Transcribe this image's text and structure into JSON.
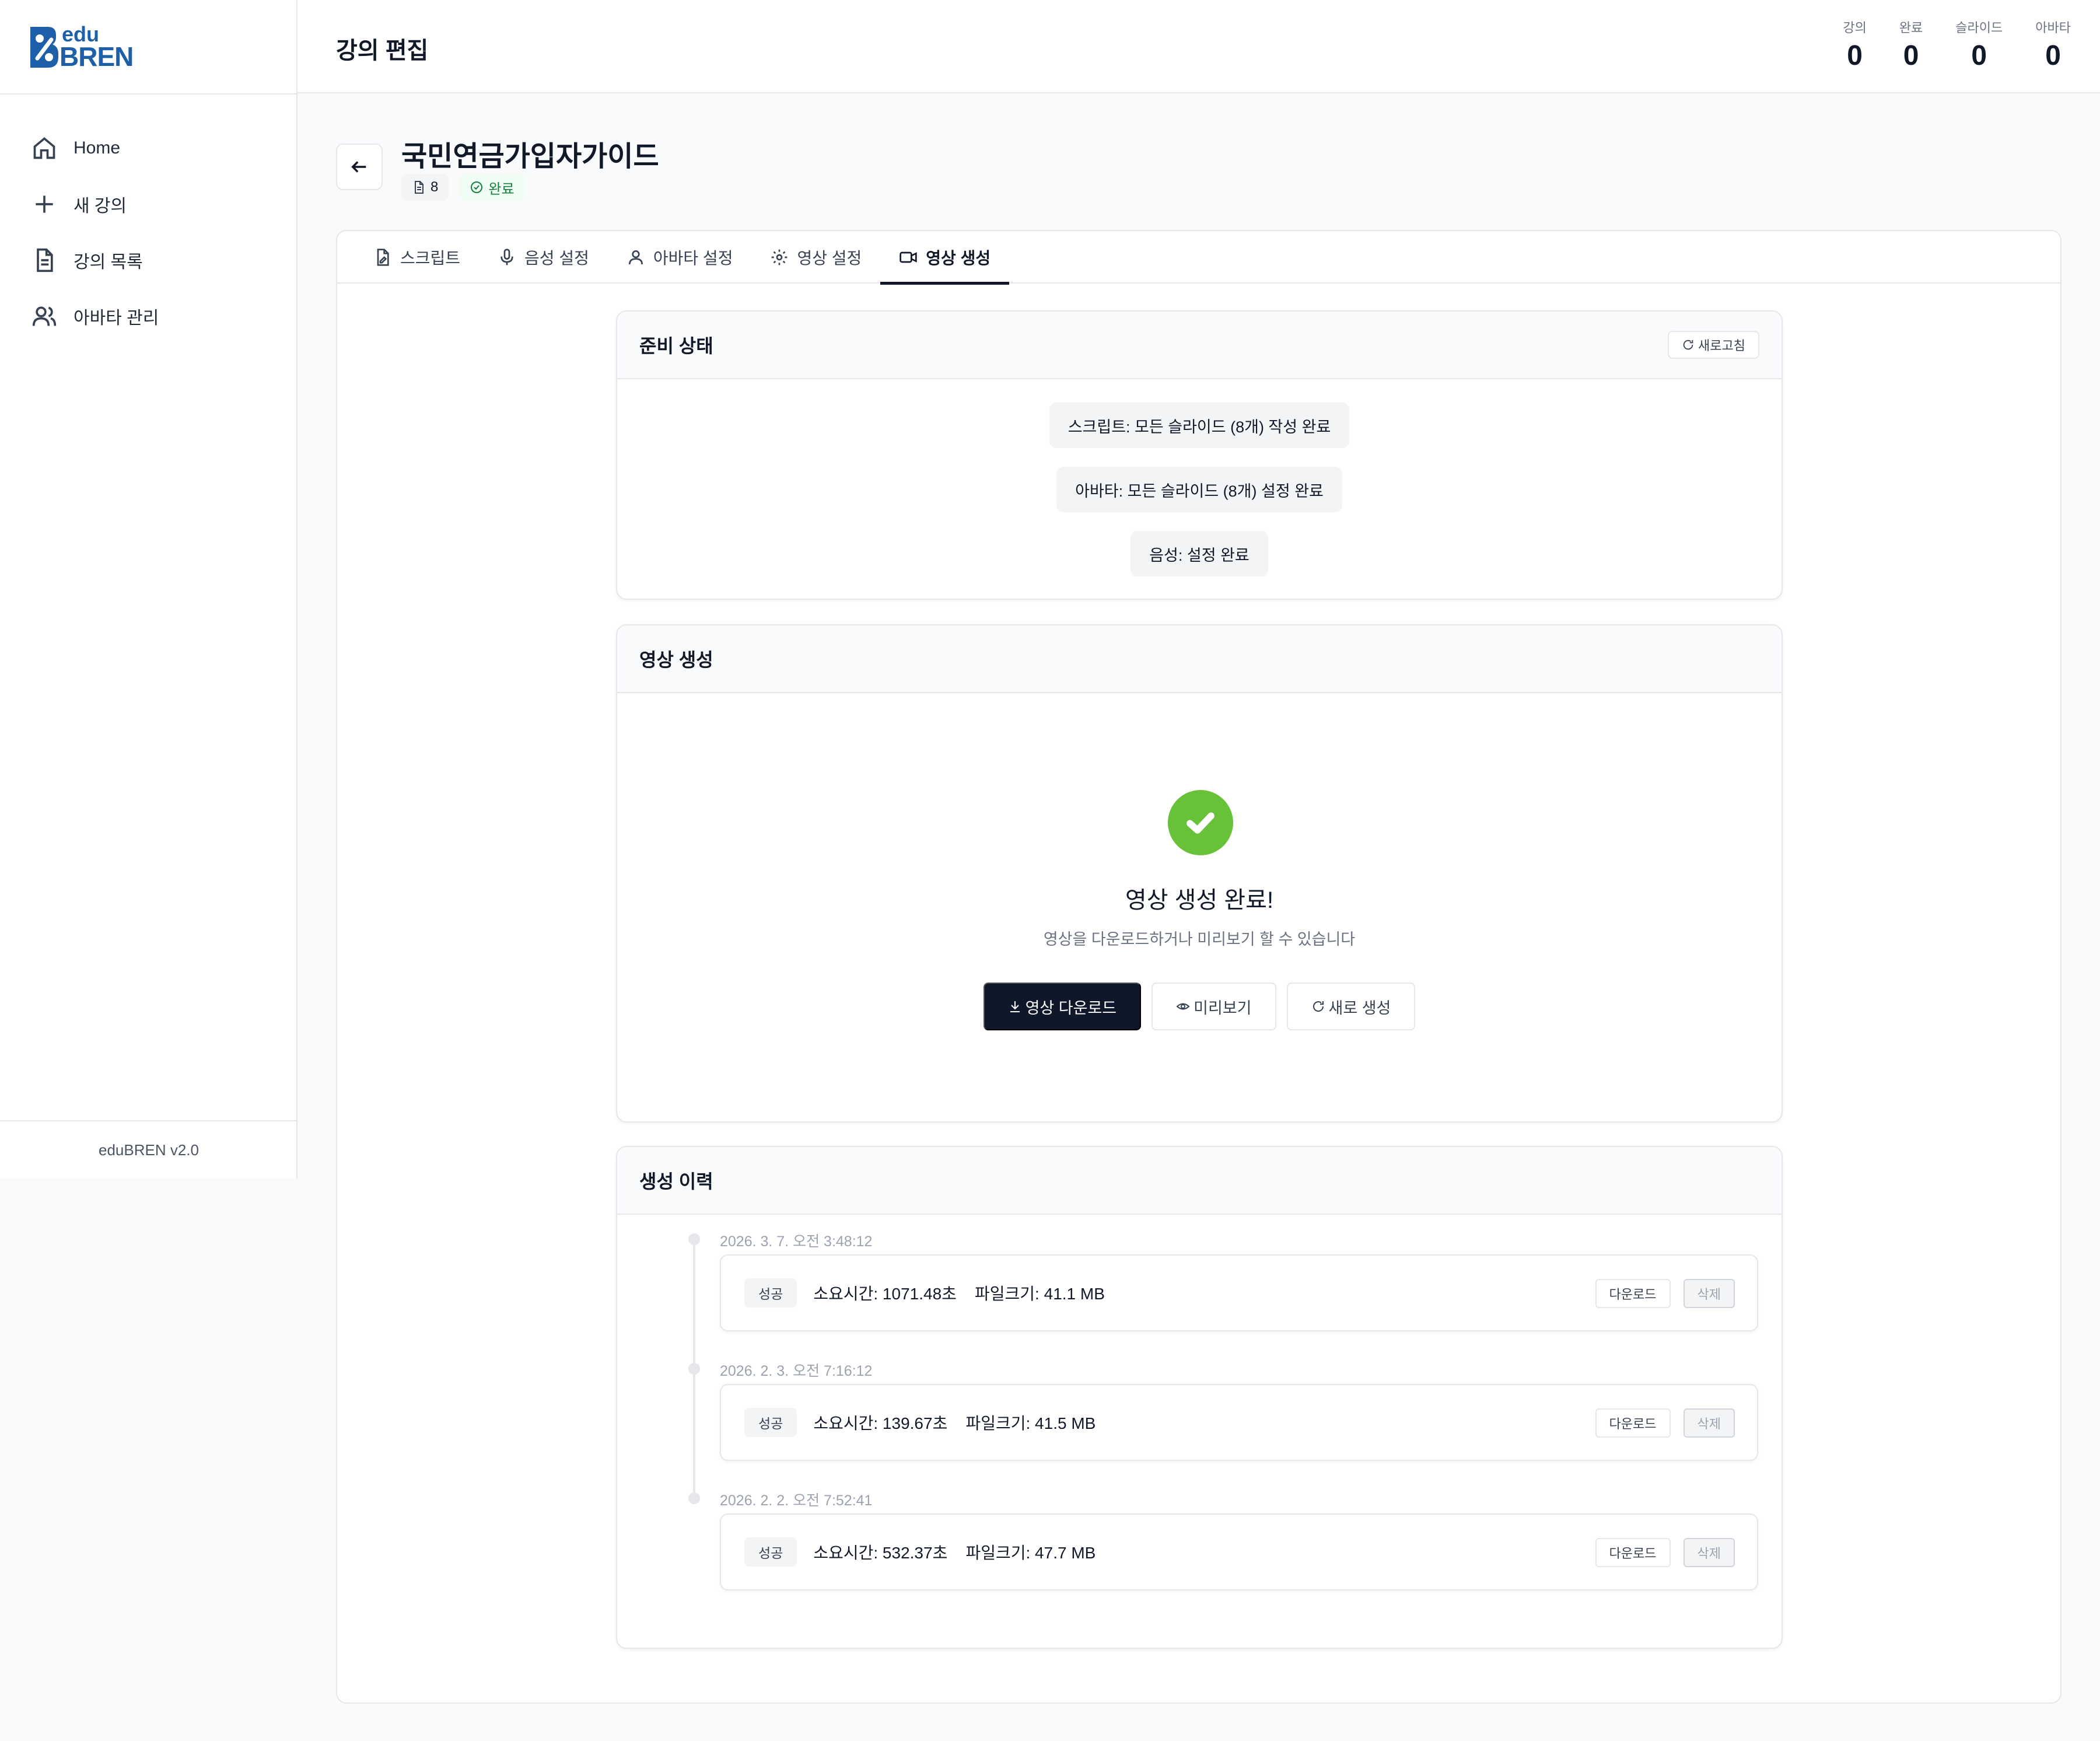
{
  "app": {
    "logo_top": "edu",
    "logo_bottom": "BREN",
    "version": "eduBREN v2.0",
    "brand_color": "#1d5fa8"
  },
  "sidebar": {
    "items": [
      {
        "label": "Home",
        "icon": "home-icon"
      },
      {
        "label": "새 강의",
        "icon": "plus-icon"
      },
      {
        "label": "강의 목록",
        "icon": "document-icon"
      },
      {
        "label": "아바타 관리",
        "icon": "users-icon"
      }
    ]
  },
  "header": {
    "title": "강의 편집",
    "stats": [
      {
        "label": "강의",
        "value": "0"
      },
      {
        "label": "완료",
        "value": "0"
      },
      {
        "label": "슬라이드",
        "value": "0"
      },
      {
        "label": "아바타",
        "value": "0"
      }
    ]
  },
  "lecture": {
    "title": "국민연금가입자가이드",
    "slide_count": "8",
    "status": "완료"
  },
  "tabs": [
    {
      "label": "스크립트",
      "icon": "script-edit-icon",
      "active": false
    },
    {
      "label": "음성 설정",
      "icon": "microphone-icon",
      "active": false
    },
    {
      "label": "아바타 설정",
      "icon": "user-icon",
      "active": false
    },
    {
      "label": "영상 설정",
      "icon": "gear-icon",
      "active": false
    },
    {
      "label": "영상 생성",
      "icon": "video-icon",
      "active": true
    }
  ],
  "readiness": {
    "title": "준비 상태",
    "refresh_label": "새로고침",
    "items": [
      "스크립트: 모든 슬라이드 (8개) 작성 완료",
      "아바타: 모든 슬라이드 (8개) 설정 완료",
      "음성: 설정 완료"
    ]
  },
  "generation": {
    "title": "영상 생성",
    "done_title": "영상 생성 완료!",
    "done_sub": "영상을 다운로드하거나 미리보기 할 수 있습니다",
    "download_label": "영상 다운로드",
    "preview_label": "미리보기",
    "regenerate_label": "새로 생성",
    "success_color": "#67c23a"
  },
  "history": {
    "title": "생성 이력",
    "download_label": "다운로드",
    "delete_label": "삭제",
    "entries": [
      {
        "time": "2026. 3. 7. 오전 3:48:12",
        "status": "성공",
        "info": "소요시간: 1071.48초    파일크기: 41.1 MB"
      },
      {
        "time": "2026. 2. 3. 오전 7:16:12",
        "status": "성공",
        "info": "소요시간: 139.67초    파일크기: 41.5 MB"
      },
      {
        "time": "2026. 2. 2. 오전 7:52:41",
        "status": "성공",
        "info": "소요시간: 532.37초    파일크기: 47.7 MB"
      }
    ]
  }
}
